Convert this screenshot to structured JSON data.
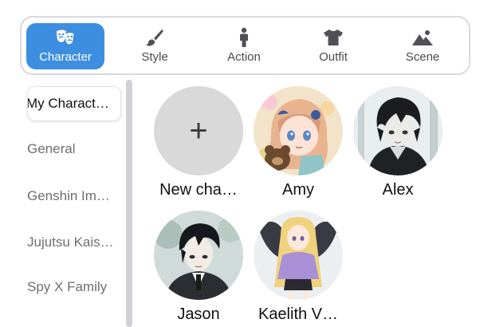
{
  "tabs": [
    {
      "label": "Character",
      "icon": "masks-icon",
      "active": true
    },
    {
      "label": "Style",
      "icon": "brush-icon",
      "active": false
    },
    {
      "label": "Action",
      "icon": "person-icon",
      "active": false
    },
    {
      "label": "Outfit",
      "icon": "shirt-icon",
      "active": false
    },
    {
      "label": "Scene",
      "icon": "mountain-icon",
      "active": false
    }
  ],
  "sidebar": {
    "items": [
      {
        "label": "My Charact…",
        "active": true
      },
      {
        "label": "General",
        "active": false
      },
      {
        "label": "Genshin Im…",
        "active": false
      },
      {
        "label": "Jujutsu Kais…",
        "active": false
      },
      {
        "label": "Spy X Family",
        "active": false
      }
    ]
  },
  "characters": [
    {
      "name": "New cha…",
      "type": "new",
      "plus": "+"
    },
    {
      "name": "Amy"
    },
    {
      "name": "Alex"
    },
    {
      "name": "Jason"
    },
    {
      "name": "Kaelith V…"
    }
  ],
  "colors": {
    "accent": "#3d8ee0",
    "inactive_text": "#6e6e73",
    "new_card_bg": "#d9d9d9"
  }
}
